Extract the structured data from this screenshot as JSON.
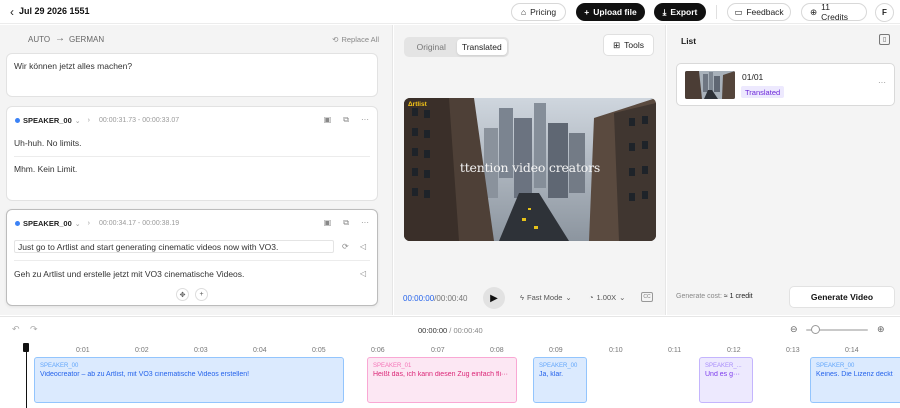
{
  "header": {
    "title": "Jul 29 2026 1551",
    "pricing": "Pricing",
    "upload": "Upload file",
    "export": "Export",
    "feedback": "Feedback",
    "credits": "11 Credits",
    "avatar": "F"
  },
  "editor": {
    "source_lang": "AUTO",
    "target_lang": "GERMAN",
    "replace_all": "Replace All",
    "first_card_text": "Wir können jetzt alles machen?",
    "segments": [
      {
        "speaker": "SPEAKER_00",
        "time": "00:00:31.73 - 00:00:33.07",
        "original": "Uh-huh. No limits.",
        "translated": "Mhm. Kein Limit."
      },
      {
        "speaker": "SPEAKER_00",
        "time": "00:00:34.17 - 00:00:38.19",
        "original": "Just go to Artlist and start generating cinematic videos now with VO3.",
        "translated": "Geh zu Artlist und erstelle jetzt mit VO3 cinematische Videos."
      }
    ]
  },
  "preview": {
    "tab_original": "Original",
    "tab_translated": "Translated",
    "active_tab": "Translated",
    "tools": "Tools",
    "video_caption": "ttention video creators",
    "video_badge": "Δrtlist",
    "current_time": "00:00:00",
    "duration": "/00:00:40",
    "mode": "Fast Mode",
    "speed": "1.00X",
    "cc": "CC"
  },
  "list": {
    "title": "List",
    "item_name": "01/01",
    "item_status": "Translated",
    "generate_cost_label": "Generate cost:",
    "generate_cost_value": "≈ 1 credit",
    "generate_button": "Generate Video"
  },
  "timeline": {
    "current": "00:00:00",
    "separator": " / ",
    "duration": "00:00:40",
    "zoom_level": 0.15,
    "ticks": [
      "0:01",
      "0:02",
      "0:03",
      "0:04",
      "0:05",
      "0:06",
      "0:07",
      "0:08",
      "0:09",
      "0:10",
      "0:11",
      "0:12",
      "0:13",
      "0:14"
    ],
    "blocks": [
      {
        "speaker": "SPEAKER_00",
        "text": "Videocreator – ab zu Artlist, mit VO3 cinematische Videos erstellen!",
        "color": "blue"
      },
      {
        "speaker": "SPEAKER_01",
        "text": "Heißt das, ich kann diesen Zug einfach fli···",
        "color": "pink"
      },
      {
        "speaker": "SPEAKER_00",
        "text": "Ja, klar.",
        "color": "blue"
      },
      {
        "speaker": "SPEAKER_...",
        "text": "Und es g···",
        "color": "purple"
      },
      {
        "speaker": "SPEAKER_00",
        "text": "Keines. Die Lizenz deckt all···",
        "color": "blue"
      }
    ]
  },
  "colors": {
    "accent_blue": "#2563eb",
    "dark_button": "#111111",
    "translated_badge_bg": "#ede9fe",
    "translated_badge_fg": "#6d28d9"
  }
}
